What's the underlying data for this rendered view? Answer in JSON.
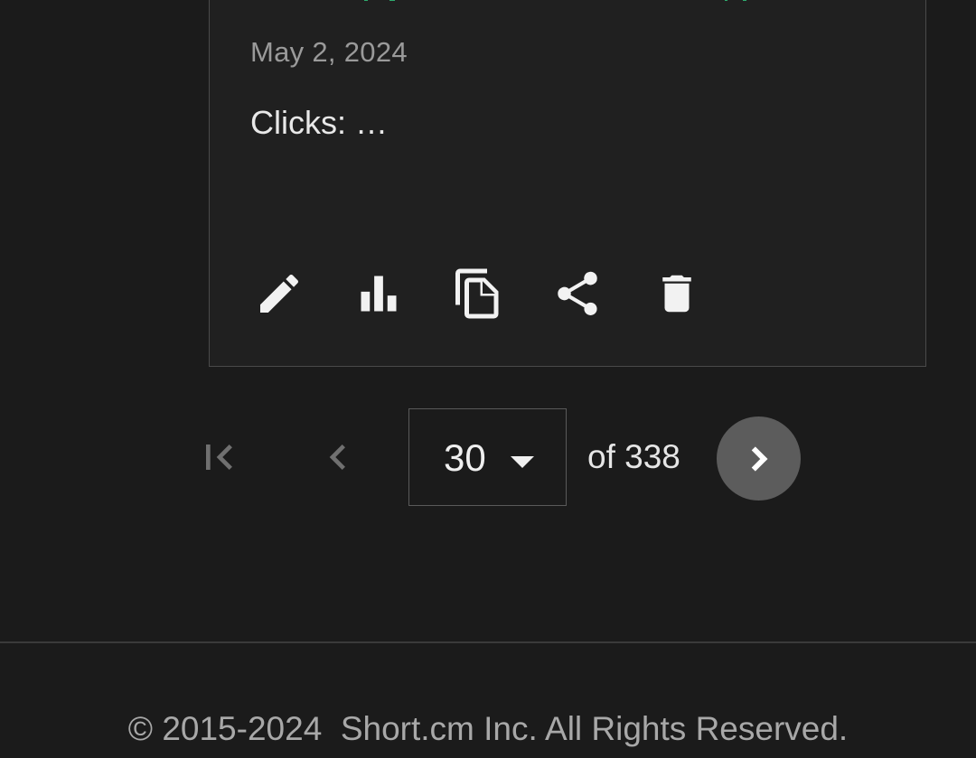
{
  "card": {
    "date": "May 2, 2024",
    "clicks": "Clicks: …",
    "actions": {
      "edit_icon": "pencil-icon",
      "stats_icon": "bar-chart-icon",
      "duplicate_icon": "copy-icon",
      "share_icon": "share-icon",
      "delete_icon": "trash-icon"
    }
  },
  "pagination": {
    "current_page": "30",
    "of_total": "of 338",
    "first_icon": "first-page-icon",
    "prev_icon": "chevron-left-icon",
    "next_icon": "chevron-right-icon"
  },
  "footer": {
    "copyright": "© 2015-2024  Short.cm Inc. All Rights Reserved."
  },
  "colors": {
    "background": "#1b1b1b",
    "card_background": "#202020",
    "link_accent": "#2eaa6e",
    "next_button": "#5c5c5c"
  }
}
